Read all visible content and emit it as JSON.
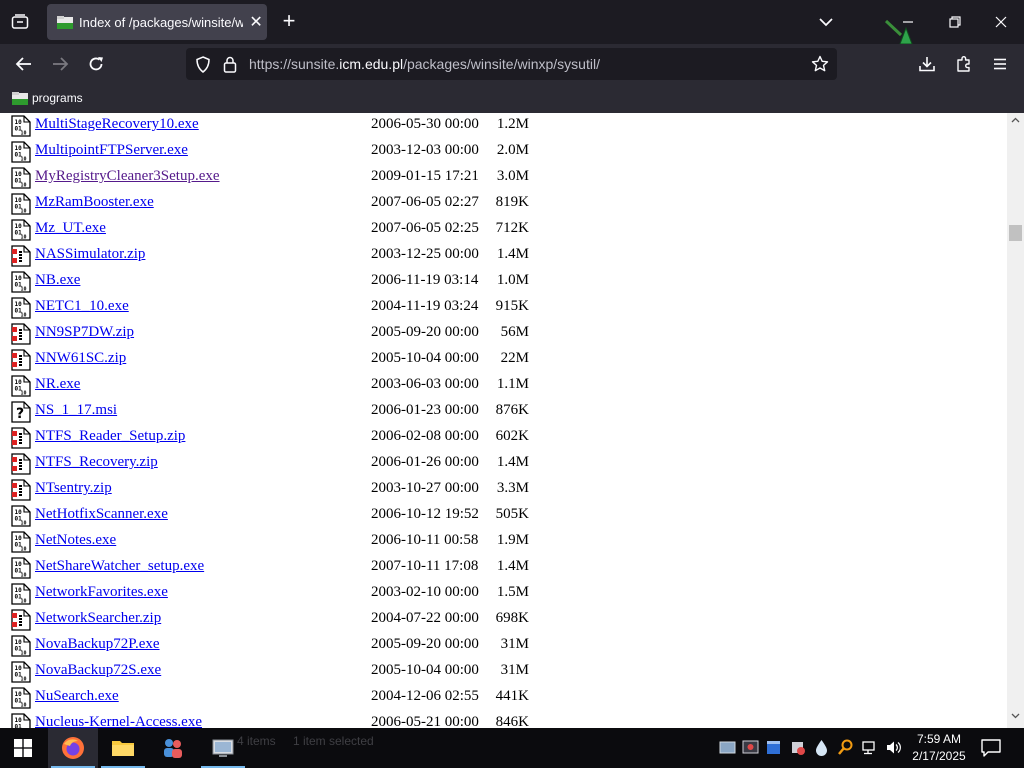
{
  "browser": {
    "tab_title": "Index of /packages/winsite/winxp/sysutil/",
    "url_prefix": "https://sunsite.",
    "url_host": "icm.edu.pl",
    "url_path": "/packages/winsite/winxp/sysutil/"
  },
  "bookmarks": [
    {
      "label": "programs"
    }
  ],
  "listing": [
    {
      "name": "MultiStageRecovery10.exe",
      "date": "2006-05-30 00:00",
      "size": "1.2M",
      "icon": "binary-file-icon",
      "visited": false
    },
    {
      "name": "MultipointFTPServer.exe",
      "date": "2003-12-03 00:00",
      "size": "2.0M",
      "icon": "binary-file-icon",
      "visited": false
    },
    {
      "name": "MyRegistryCleaner3Setup.exe",
      "date": "2009-01-15 17:21",
      "size": "3.0M",
      "icon": "binary-file-icon",
      "visited": true
    },
    {
      "name": "MzRamBooster.exe",
      "date": "2007-06-05 02:27",
      "size": "819K",
      "icon": "binary-file-icon",
      "visited": false
    },
    {
      "name": "Mz_UT.exe",
      "date": "2007-06-05 02:25",
      "size": "712K",
      "icon": "binary-file-icon",
      "visited": false
    },
    {
      "name": "NASSimulator.zip",
      "date": "2003-12-25 00:00",
      "size": "1.4M",
      "icon": "compressed-file-icon",
      "visited": false
    },
    {
      "name": "NB.exe",
      "date": "2006-11-19 03:14",
      "size": "1.0M",
      "icon": "binary-file-icon",
      "visited": false
    },
    {
      "name": "NETC1_10.exe",
      "date": "2004-11-19 03:24",
      "size": "915K",
      "icon": "binary-file-icon",
      "visited": false
    },
    {
      "name": "NN9SP7DW.zip",
      "date": "2005-09-20 00:00",
      "size": "56M",
      "icon": "compressed-file-icon",
      "visited": false
    },
    {
      "name": "NNW61SC.zip",
      "date": "2005-10-04 00:00",
      "size": "22M",
      "icon": "compressed-file-icon",
      "visited": false
    },
    {
      "name": "NR.exe",
      "date": "2003-06-03 00:00",
      "size": "1.1M",
      "icon": "binary-file-icon",
      "visited": false
    },
    {
      "name": "NS_1_17.msi",
      "date": "2006-01-23 00:00",
      "size": "876K",
      "icon": "unknown-file-icon",
      "visited": false
    },
    {
      "name": "NTFS_Reader_Setup.zip",
      "date": "2006-02-08 00:00",
      "size": "602K",
      "icon": "compressed-file-icon",
      "visited": false
    },
    {
      "name": "NTFS_Recovery.zip",
      "date": "2006-01-26 00:00",
      "size": "1.4M",
      "icon": "compressed-file-icon",
      "visited": false
    },
    {
      "name": "NTsentry.zip",
      "date": "2003-10-27 00:00",
      "size": "3.3M",
      "icon": "compressed-file-icon",
      "visited": false
    },
    {
      "name": "NetHotfixScanner.exe",
      "date": "2006-10-12 19:52",
      "size": "505K",
      "icon": "binary-file-icon",
      "visited": false
    },
    {
      "name": "NetNotes.exe",
      "date": "2006-10-11 00:58",
      "size": "1.9M",
      "icon": "binary-file-icon",
      "visited": false
    },
    {
      "name": "NetShareWatcher_setup.exe",
      "date": "2007-10-11 17:08",
      "size": "1.4M",
      "icon": "binary-file-icon",
      "visited": false
    },
    {
      "name": "NetworkFavorites.exe",
      "date": "2003-02-10 00:00",
      "size": "1.5M",
      "icon": "binary-file-icon",
      "visited": false
    },
    {
      "name": "NetworkSearcher.zip",
      "date": "2004-07-22 00:00",
      "size": "698K",
      "icon": "compressed-file-icon",
      "visited": false
    },
    {
      "name": "NovaBackup72P.exe",
      "date": "2005-09-20 00:00",
      "size": "31M",
      "icon": "binary-file-icon",
      "visited": false
    },
    {
      "name": "NovaBackup72S.exe",
      "date": "2005-10-04 00:00",
      "size": "31M",
      "icon": "binary-file-icon",
      "visited": false
    },
    {
      "name": "NuSearch.exe",
      "date": "2004-12-06 02:55",
      "size": "441K",
      "icon": "binary-file-icon",
      "visited": false
    },
    {
      "name": "Nucleus-Kernel-Access.exe",
      "date": "2006-05-21 00:00",
      "size": "846K",
      "icon": "binary-file-icon",
      "visited": false
    }
  ],
  "taskbar": {
    "ghost_items": "4 items",
    "ghost_selected": "1 item selected",
    "time": "7:59 AM",
    "date": "2/17/2025"
  },
  "colors": {
    "link": "#0000ee",
    "visited_link": "#551a8b",
    "tab_active": "#42414d",
    "toolbar": "#2b2a33"
  }
}
